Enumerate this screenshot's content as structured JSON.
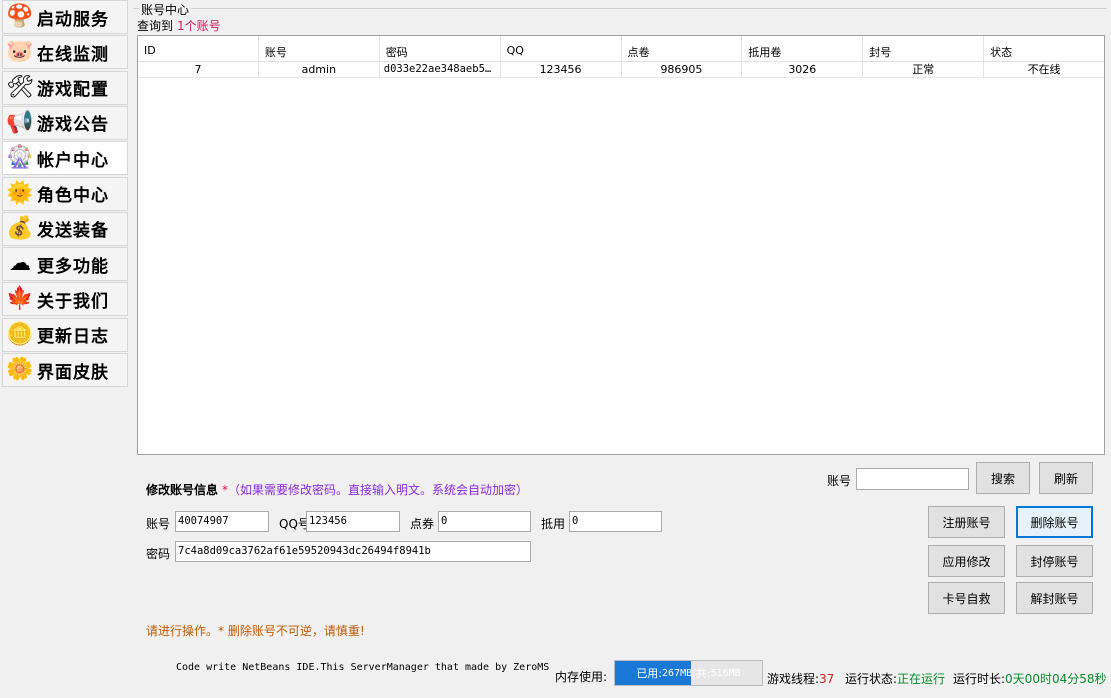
{
  "sidebar": {
    "items": [
      {
        "label": "启动服务",
        "icon": "mushroom-house-icon",
        "glyph": "🍄",
        "active": false
      },
      {
        "label": "在线监测",
        "icon": "pig-face-icon",
        "glyph": "🐷",
        "active": false
      },
      {
        "label": "游戏配置",
        "icon": "tools-icon",
        "glyph": "🛠",
        "active": false
      },
      {
        "label": "游戏公告",
        "icon": "megaphone-icon",
        "glyph": "📢",
        "active": false
      },
      {
        "label": "帐户中心",
        "icon": "pinwheel-icon",
        "glyph": "🎡",
        "active": true
      },
      {
        "label": "角色中心",
        "icon": "sun-face-icon",
        "glyph": "🌞",
        "active": false
      },
      {
        "label": "发送装备",
        "icon": "money-bag-icon",
        "glyph": "💰",
        "active": false
      },
      {
        "label": "更多功能",
        "icon": "cloud-icon",
        "glyph": "☁",
        "active": false
      },
      {
        "label": "关于我们",
        "icon": "maple-leaf-icon",
        "glyph": "🍁",
        "active": false
      },
      {
        "label": "更新日志",
        "icon": "gold-coin-icon",
        "glyph": "🪙",
        "active": false
      },
      {
        "label": "界面皮肤",
        "icon": "flower-icon",
        "glyph": "🌼",
        "active": false
      }
    ]
  },
  "account_center": {
    "group_title": "账号中心",
    "query_prefix": "查询到",
    "query_count": "1个账号",
    "columns": [
      "ID",
      "账号",
      "密码",
      "QQ",
      "点卷",
      "抵用卷",
      "封号",
      "状态"
    ],
    "rows": [
      [
        "7",
        "admin",
        "d033e22ae348aeb5...",
        "123456",
        "986905",
        "3026",
        "正常",
        "不在线"
      ]
    ]
  },
  "search": {
    "label": "账号",
    "value": "",
    "search_button": "搜索",
    "refresh_button": "刷新"
  },
  "edit": {
    "title": "修改账号信息",
    "hint_star": "*",
    "hint": "（如果需要修改密码。直接输入明文。系统会自动加密）",
    "account_label": "账号",
    "account_value": "40074907",
    "qq_label": "QQ号",
    "qq_value": "123456",
    "points_label": "点券",
    "points_value": "0",
    "voucher_label": "抵用",
    "voucher_value": "0",
    "password_label": "密码",
    "password_value": "7c4a8d09ca3762af61e59520943dc26494f8941b"
  },
  "buttons": {
    "register": "注册账号",
    "delete": "删除账号",
    "apply": "应用修改",
    "ban": "封停账号",
    "card_self_rescue": "卡号自救",
    "unban": "解封账号"
  },
  "status_message": "请进行操作。* 删除账号不可逆，请慎重!",
  "footer": {
    "credit": "Code write NetBeans IDE.This ServerManager that made by ZeroMS",
    "memory_label": "内存使用:",
    "memory_used_prefix": "已用:",
    "memory_used": "267MB",
    "memory_total_prefix": "/共:",
    "memory_total": "516MB",
    "memory_fraction": 0.517,
    "threads_label": "游戏线程:",
    "threads_value": "37",
    "run_status_label": "运行状态:",
    "run_status_value": "正在运行",
    "uptime_label": "运行时长:",
    "uptime_value": "0天00时04分58秒"
  },
  "colors": {
    "accent": "#1a78d6",
    "count_red": "#d4145a",
    "hint_purple": "#8a2be2",
    "status_orange": "#c05a00",
    "running_green": "#0a8a2a"
  }
}
